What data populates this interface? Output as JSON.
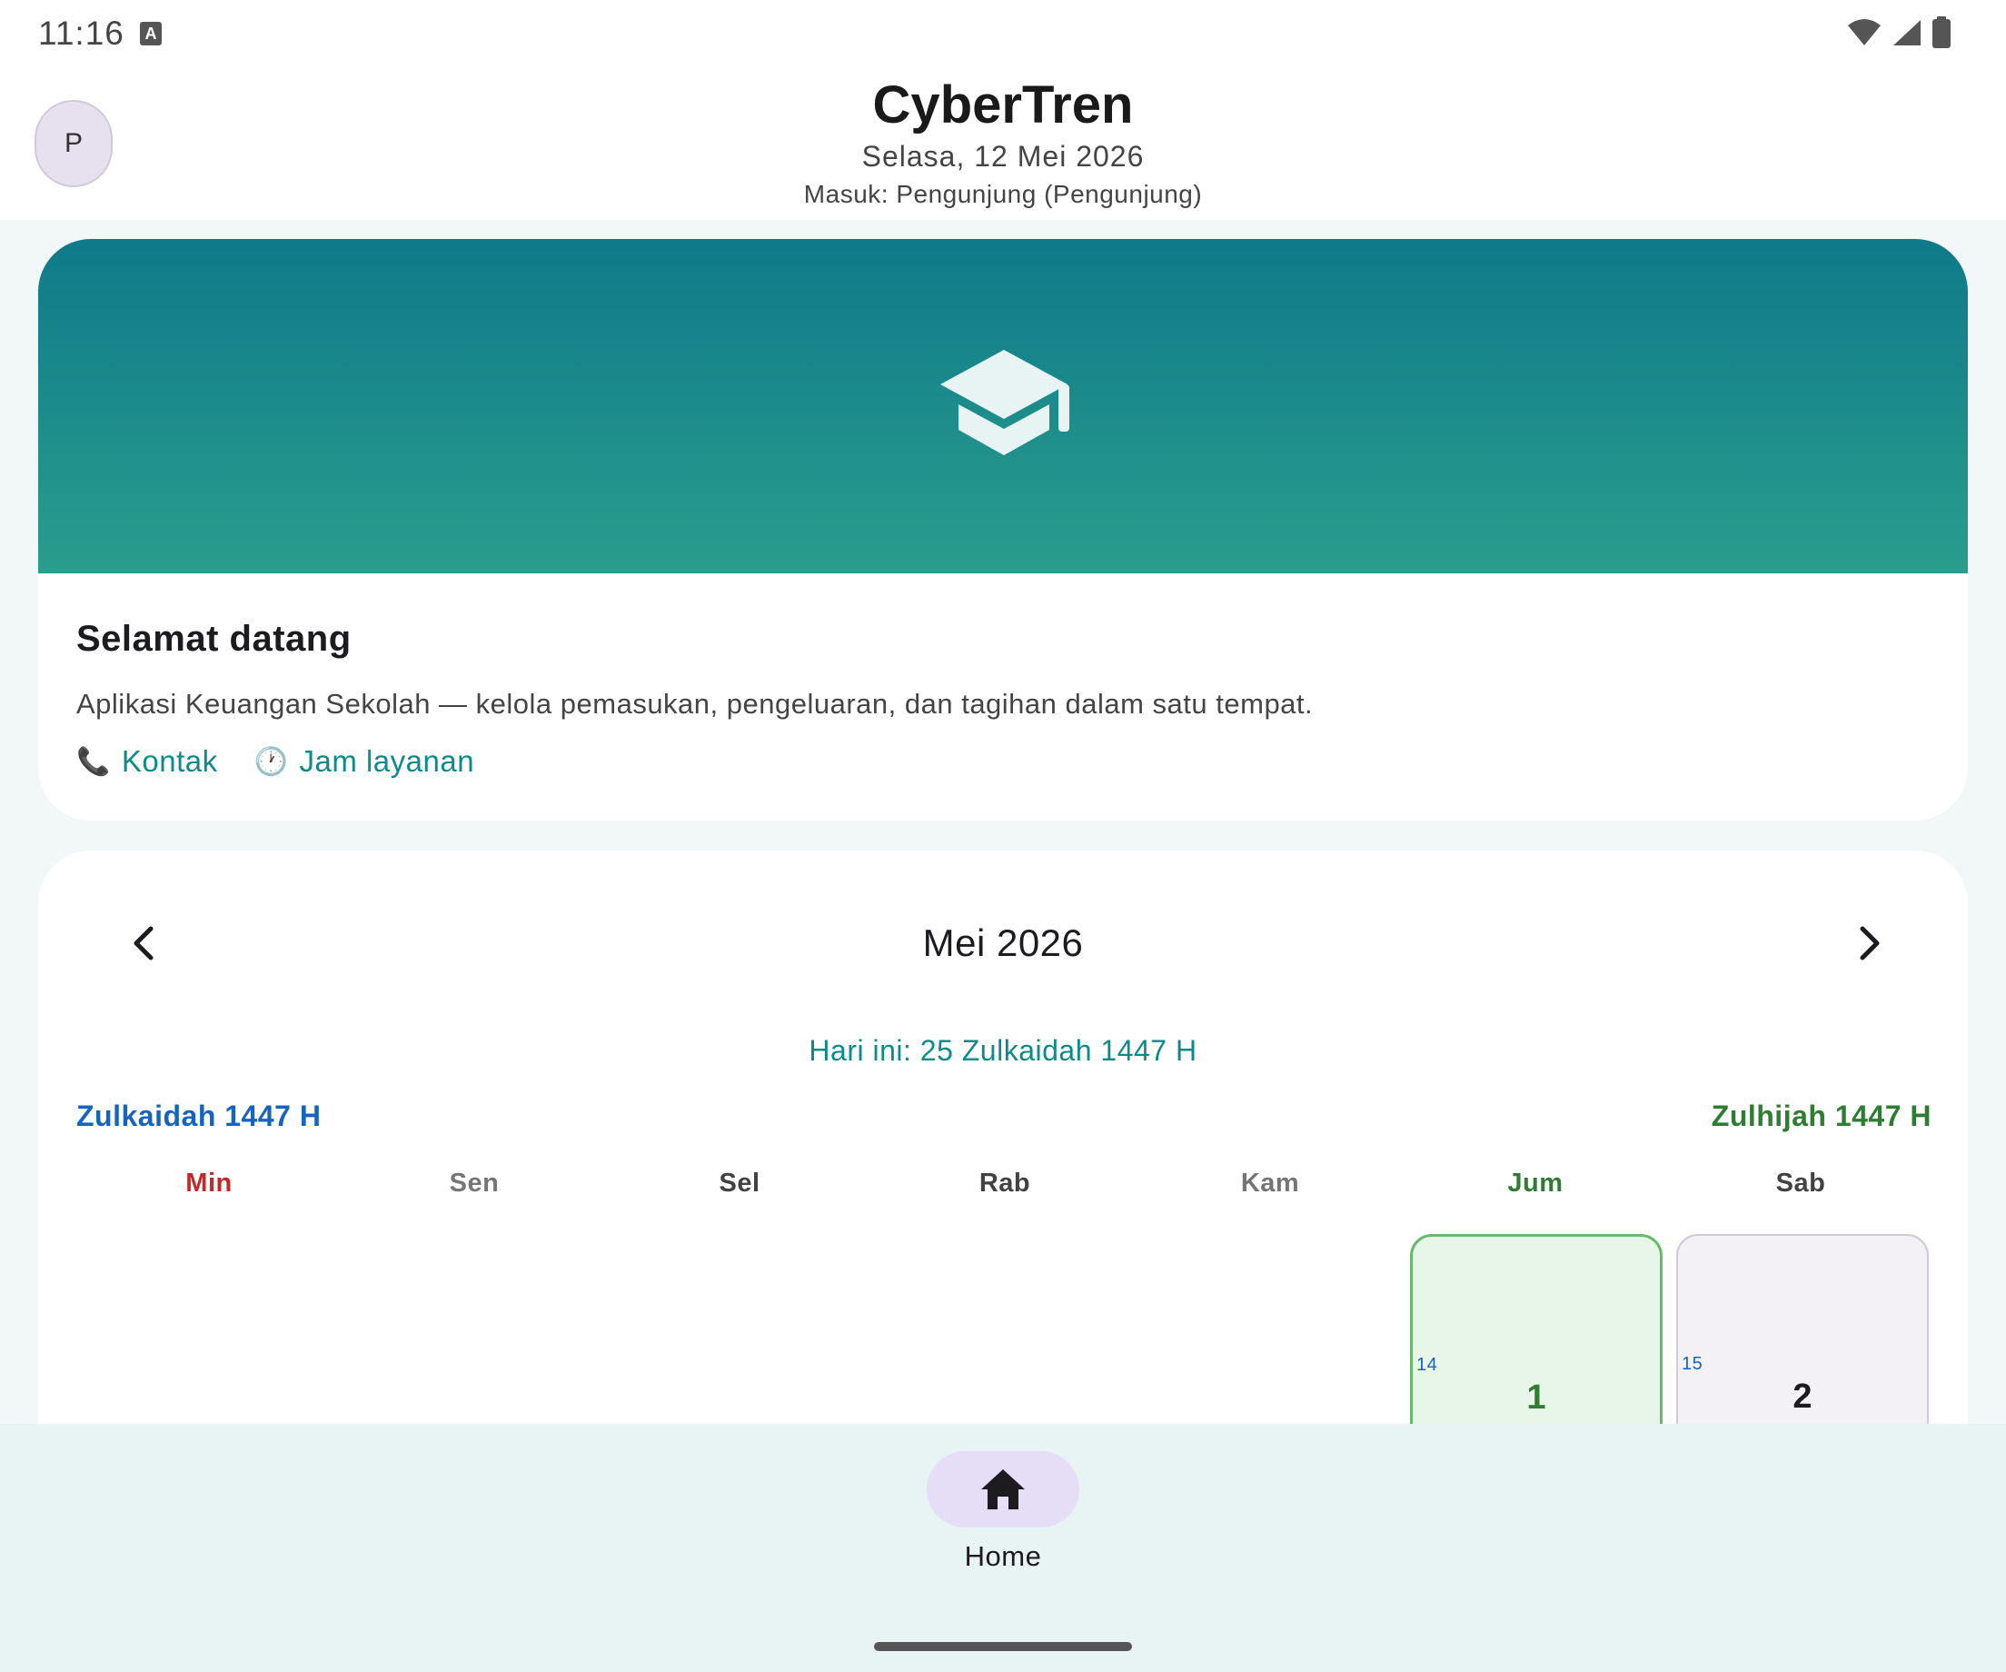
{
  "status_bar": {
    "time": "11:16",
    "notification_icon": "a-keyboard-icon",
    "icons": [
      "wifi-icon",
      "signal-icon",
      "battery-icon"
    ]
  },
  "header": {
    "avatar_initial": "P",
    "title": "CyberTren",
    "date": "Selasa, 12 Mei 2026",
    "login_status": "Masuk: Pengunjung (Pengunjung)"
  },
  "welcome_card": {
    "icon": "graduation-cap-icon",
    "title": "Selamat datang",
    "description": "Aplikasi Keuangan Sekolah — kelola pemasukan, pengeluaran, dan tagihan dalam satu tempat.",
    "links": [
      {
        "icon": "phone-icon",
        "glyph": "📞",
        "label": "Kontak"
      },
      {
        "icon": "clock-icon",
        "glyph": "🕐",
        "label": "Jam layanan"
      }
    ],
    "banner_gradient": [
      "#0e7a8a",
      "#2a9d8c"
    ]
  },
  "calendar": {
    "month_label": "Mei 2026",
    "today_hijri": "Hari ini: 25 Zulkaidah 1447 H",
    "hijri_month_left": "Zulkaidah 1447 H",
    "hijri_month_right": "Zulhijah 1447 H",
    "weekdays": [
      {
        "label": "Min",
        "color": "#c62828"
      },
      {
        "label": "Sen",
        "color": "#757575"
      },
      {
        "label": "Sel",
        "color": "#424242"
      },
      {
        "label": "Rab",
        "color": "#424242"
      },
      {
        "label": "Kam",
        "color": "#757575"
      },
      {
        "label": "Jum",
        "color": "#2e7d32"
      },
      {
        "label": "Sab",
        "color": "#424242"
      }
    ],
    "days": [
      {
        "hijri": "14",
        "gregorian": "1",
        "weekday": "Jum",
        "color": "#2e7d32"
      },
      {
        "hijri": "15",
        "gregorian": "2",
        "weekday": "Sab",
        "color": "#1c1b1f"
      }
    ]
  },
  "bottom_nav": {
    "items": [
      {
        "icon": "home-icon",
        "label": "Home",
        "active": true
      }
    ]
  },
  "colors": {
    "accent": "#0e8a8a",
    "hijri_blue": "#1565c0",
    "hijri_green": "#2e7d32"
  }
}
